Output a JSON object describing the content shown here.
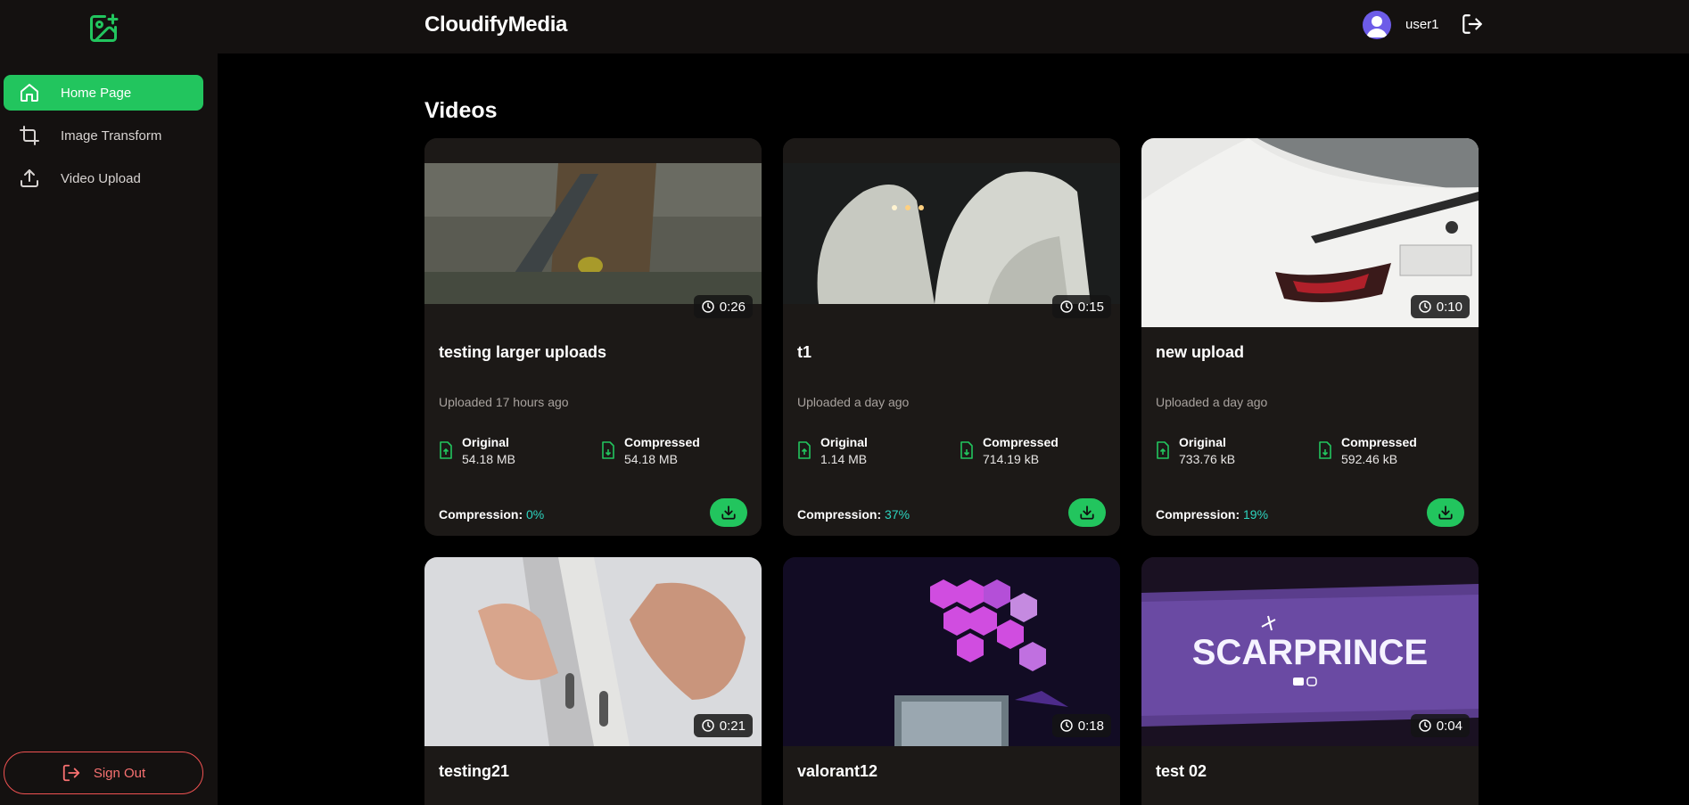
{
  "app": {
    "brand": "CloudifyMedia"
  },
  "sidebar": {
    "items": [
      {
        "label": "Home Page",
        "icon": "home-icon",
        "active": true
      },
      {
        "label": "Image Transform",
        "icon": "crop-icon",
        "active": false
      },
      {
        "label": "Video Upload",
        "icon": "upload-icon",
        "active": false
      }
    ],
    "signout_label": "Sign Out"
  },
  "header": {
    "username": "user1"
  },
  "main": {
    "title": "Videos",
    "videos": [
      {
        "title": "testing larger uploads",
        "duration": "0:26",
        "uploaded": "Uploaded 17 hours ago",
        "original_label": "Original",
        "original": "54.18 MB",
        "compressed_label": "Compressed",
        "compressed": "54.18 MB",
        "compression_label": "Compression:",
        "compression": "0%"
      },
      {
        "title": "t1",
        "duration": "0:15",
        "uploaded": "Uploaded a day ago",
        "original_label": "Original",
        "original": "1.14 MB",
        "compressed_label": "Compressed",
        "compressed": "714.19 kB",
        "compression_label": "Compression:",
        "compression": "37%"
      },
      {
        "title": "new upload",
        "duration": "0:10",
        "uploaded": "Uploaded a day ago",
        "original_label": "Original",
        "original": "733.76 kB",
        "compressed_label": "Compressed",
        "compressed": "592.46 kB",
        "compression_label": "Compression:",
        "compression": "19%"
      },
      {
        "title": "testing21",
        "duration": "0:21"
      },
      {
        "title": "valorant12",
        "duration": "0:18"
      },
      {
        "title": "test 02",
        "duration": "0:04",
        "thumb_text": "SCARPRINCE"
      }
    ]
  },
  "colors": {
    "accent": "#22c55e",
    "danger": "#f05252",
    "teal": "#2dd4bf",
    "panel": "#1c1917",
    "sidebar": "#141110"
  }
}
